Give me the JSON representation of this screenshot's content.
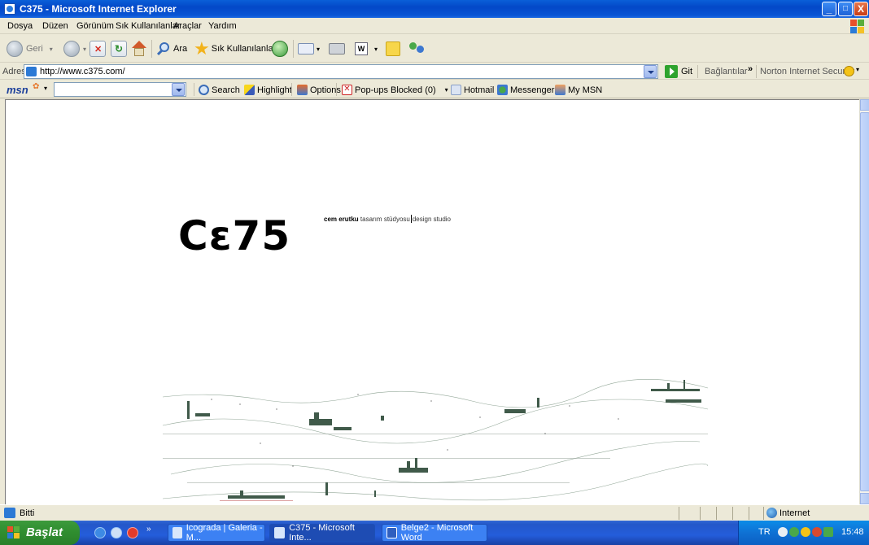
{
  "window": {
    "title": "C375 - Microsoft Internet Explorer",
    "minimize": "_",
    "maximize": "□",
    "close": "X"
  },
  "menu": [
    "Dosya",
    "Düzen",
    "Görünüm",
    "Sık Kullanılanlar",
    "Araçlar",
    "Yardım"
  ],
  "toolbar": {
    "back": "Geri",
    "search": "Ara",
    "favorites": "Sık Kullanılanlar"
  },
  "address": {
    "label": "Adres",
    "url": "http://www.c375.com/",
    "go": "Git",
    "links": "Bağlantılar",
    "norton": "Norton Internet Security"
  },
  "msn": {
    "logo": "msn",
    "search": "Search",
    "highlight": "Highlight",
    "options": "Options",
    "popups": "Pop-ups Blocked (0)",
    "hotmail": "Hotmail",
    "messenger": "Messenger",
    "mymsn": "My MSN"
  },
  "page": {
    "logo": "Cε75",
    "tag_name": "cem erutku",
    "tag_tr": "tasarım stüdyosu",
    "tag_en": "design studio"
  },
  "status": {
    "text": "Bitti",
    "zone": "Internet"
  },
  "taskbar": {
    "start": "Başlat",
    "tasks": [
      "Icograda | Galeria - M...",
      "C375 - Microsoft Inte...",
      "Belge2 - Microsoft Word"
    ],
    "lang": "TR",
    "clock": "15:48"
  },
  "colors": {
    "titlebar": "#0A5FD8",
    "taskbar": "#245DDB",
    "start": "#2F8D2F",
    "chrome": "#ECE9D8"
  }
}
